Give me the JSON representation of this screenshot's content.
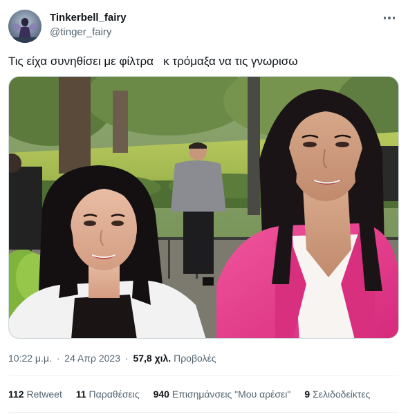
{
  "user": {
    "display_name": "Tinkerbell_fairy",
    "handle": "@tinger_fairy",
    "avatar_icon": "fairy-silhouette-avatar"
  },
  "more_icon": "more-horizontal-icon",
  "tweet": {
    "text": "Τις είχα συνηθίσει με φίλτρα   κ τρόμαξα να τις γνωρισω"
  },
  "meta": {
    "time": "10:22 μ.μ.",
    "dot1": "·",
    "date": "24 Απρ 2023",
    "dot2": "·",
    "views_count": "57,8 χιλ.",
    "views_label": "Προβολές"
  },
  "stats": {
    "retweets": {
      "count": "112",
      "label": "Retweet"
    },
    "quotes": {
      "count": "11",
      "label": "Παραθέσεις"
    },
    "likes": {
      "count": "940",
      "label": "Επισημάνσεις \"Μου αρέσει\""
    },
    "bookmarks": {
      "count": "9",
      "label": "Σελιδοδείκτες"
    }
  },
  "colors": {
    "text_primary": "#0f1419",
    "text_secondary": "#536471",
    "border": "#cfd9de",
    "blazer_pink": "#e8338a"
  }
}
